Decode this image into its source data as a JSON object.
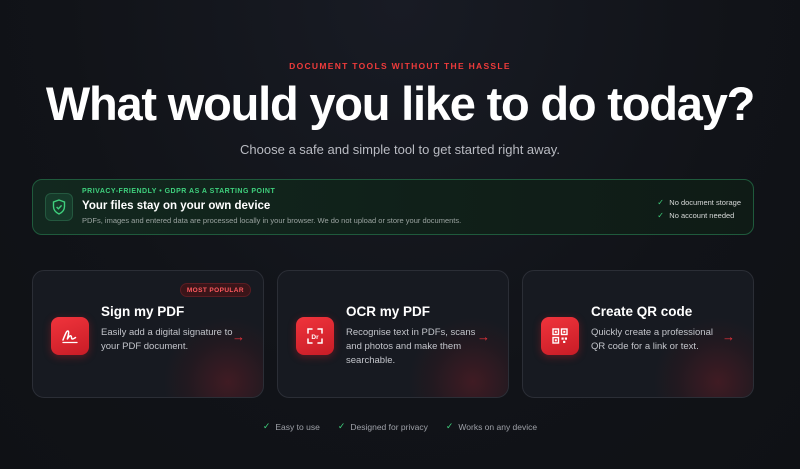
{
  "hero": {
    "eyebrow": "DOCUMENT TOOLS WITHOUT THE HASSLE",
    "headline": "What would you like to do today?",
    "subhead": "Choose a safe and simple tool to get started right away."
  },
  "privacy": {
    "icon": "shield-check-icon",
    "tag": "PRIVACY-FRIENDLY • GDPR AS A STARTING POINT",
    "title": "Your files stay on your own device",
    "description": "PDFs, images and entered data are processed locally in your browser. We do not upload or store your documents.",
    "checks": [
      "No document storage",
      "No account needed"
    ]
  },
  "tools": [
    {
      "title": "Sign my PDF",
      "description": "Easily add a digital signature to your PDF document.",
      "icon": "signature-icon",
      "badge": "MOST POPULAR",
      "arrow": "→"
    },
    {
      "title": "OCR my PDF",
      "description": "Recognise text in PDFs, scans and photos and make them searchable.",
      "icon": "ocr-scan-icon",
      "arrow": "→"
    },
    {
      "title": "Create QR code",
      "description": "Quickly create a professional QR code for a link or text.",
      "icon": "qr-code-icon",
      "arrow": "→"
    }
  ],
  "footer": {
    "features": [
      "Easy to use",
      "Designed for privacy",
      "Works on any device"
    ]
  },
  "colors": {
    "accent": "#f0343c",
    "success": "#3fd07d",
    "background": "#111318"
  }
}
